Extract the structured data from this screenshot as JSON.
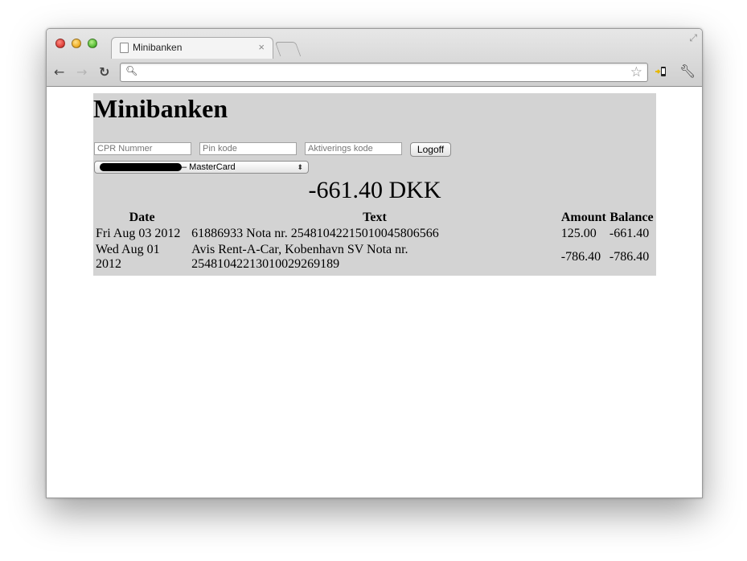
{
  "browser": {
    "tab_title": "Minibanken",
    "tab_close": "×",
    "address_value": ""
  },
  "page": {
    "title": "Minibanken",
    "login": {
      "cpr_placeholder": "CPR Nummer",
      "pin_placeholder": "Pin kode",
      "activation_placeholder": "Aktiverings kode",
      "logoff_label": "Logoff"
    },
    "account_select": {
      "selected": "– MasterCard"
    },
    "balance": "-661.40 DKK",
    "table": {
      "headers": [
        "Date",
        "Text",
        "Amount",
        "Balance"
      ],
      "rows": [
        {
          "date": "Fri Aug 03 2012",
          "text": "61886933 Nota nr. 25481042215010045806566",
          "amount": "125.00",
          "balance": "-661.40"
        },
        {
          "date": "Wed Aug 01 2012",
          "text": "Avis Rent-A-Car, Kobenhavn SV Nota nr. 25481042213010029269189",
          "amount": "-786.40",
          "balance": "-786.40"
        }
      ]
    }
  },
  "colors": {
    "panel_background": "#d3d3d3",
    "page_background": "#ffffff"
  },
  "icons": [
    "close-window-icon",
    "minimize-window-icon",
    "zoom-window-icon",
    "page-icon",
    "fullscreen-icon",
    "back-icon",
    "forward-icon",
    "reload-icon",
    "search-icon",
    "bookmark-star-icon",
    "extension-icon",
    "wrench-icon",
    "select-arrows-icon"
  ]
}
